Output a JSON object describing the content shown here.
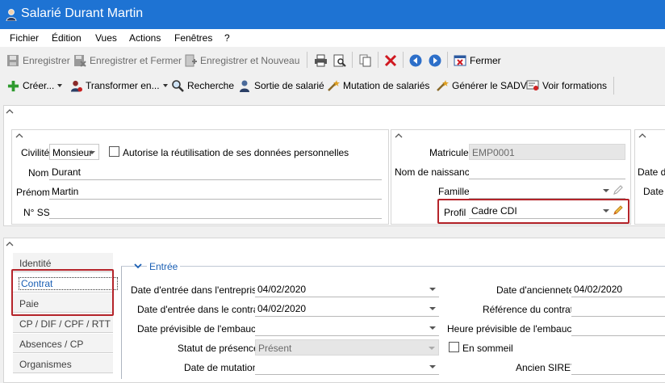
{
  "window": {
    "title": "Salarié Durant Martin"
  },
  "menu": [
    "Fichier",
    "Édition",
    "Vues",
    "Actions",
    "Fenêtres",
    "?"
  ],
  "toolbar1": {
    "save": "Enregistrer",
    "save_close": "Enregistrer et Fermer",
    "save_new": "Enregistrer et Nouveau",
    "close": "Fermer"
  },
  "toolbar2": {
    "create": "Créer...",
    "transform": "Transformer en...",
    "search": "Recherche",
    "exit": "Sortie de salarié",
    "mutation": "Mutation de salariés",
    "sadv": "Générer le SADV",
    "trainings": "Voir formations"
  },
  "identity": {
    "civility_label": "Civilité",
    "civility_value": "Monsieur",
    "consent_label": "Autorise la réutilisation de ses données personnelles",
    "lastname_label": "Nom",
    "lastname_value": "Durant",
    "firstname_label": "Prénom",
    "firstname_value": "Martin",
    "ss_label": "N° SS",
    "ss_value": ""
  },
  "employee": {
    "matricule_label": "Matricule",
    "matricule_value": "EMP0001",
    "birthname_label": "Nom de naissance",
    "birthname_value": "",
    "family_label": "Famille",
    "family_value": "",
    "profile_label": "Profil",
    "profile_value": "Cadre CDI"
  },
  "right_partial": {
    "label1": "Date d'",
    "label2": "Date"
  },
  "tabs": [
    "Identité",
    "Contrat",
    "Paie",
    "CP / DIF / CPF / RTT",
    "Absences / CP",
    "Organismes"
  ],
  "section": {
    "title": "Entrée"
  },
  "contract": {
    "entry_company_label": "Date d'entrée dans l'entreprise",
    "entry_company_value": "04/02/2020",
    "entry_contract_label": "Date d'entrée dans le contrat",
    "entry_contract_value": "04/02/2020",
    "planned_hire_label": "Date prévisible de l'embauche",
    "planned_hire_value": "",
    "presence_label": "Statut de présence",
    "presence_value": "Présent",
    "mutation_label": "Date de mutation",
    "mutation_value": "",
    "seniority_label": "Date d'ancienneté",
    "seniority_value": "04/02/2020",
    "contract_ref_label": "Référence du contrat",
    "contract_ref_value": "",
    "planned_hour_label": "Heure prévisible de l'embauche",
    "planned_hour_value": "",
    "dormant_label": "En sommeil",
    "old_siret_label": "Ancien SIRET",
    "old_siret_value": ""
  }
}
